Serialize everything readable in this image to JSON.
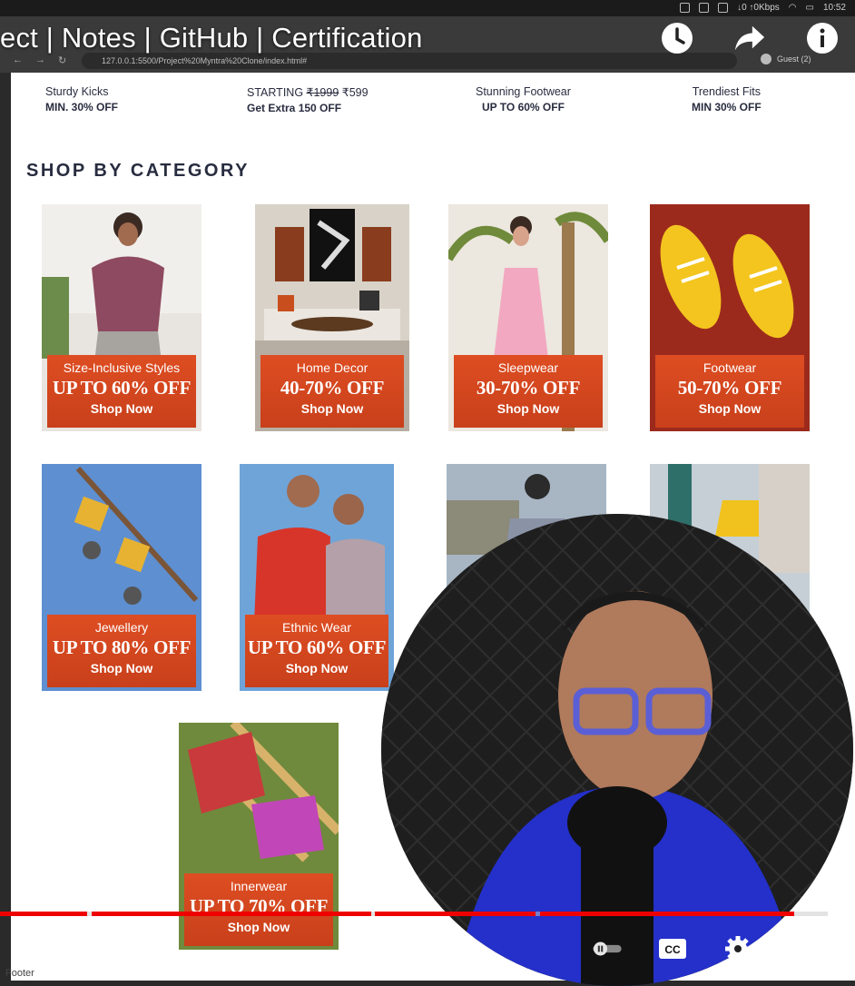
{
  "video": {
    "title": "ect | Notes | GitHub | Certification",
    "icons": [
      "clock-icon",
      "share-icon",
      "info-icon"
    ],
    "progress_fraction": 0.93,
    "cc_label": "CC"
  },
  "system_bar": {
    "time": "10:52",
    "network": "↓0 ↑0Kbps"
  },
  "browser": {
    "url": "127.0.0.1:5500/Project%20Myntra%20Clone/index.html#",
    "profile": "Guest (2)"
  },
  "promos": [
    {
      "title": "Sturdy Kicks",
      "sub": "MIN. 30% OFF"
    },
    {
      "title_prefix": "STARTING ",
      "old_price": "₹1999",
      "new_price": " ₹599",
      "sub": "Get Extra 150 OFF"
    },
    {
      "title": "Stunning Footwear",
      "sub": "UP TO 60% OFF"
    },
    {
      "title": "Trendiest Fits",
      "sub": "MIN 30% OFF"
    }
  ],
  "section_title": "SHOP BY CATEGORY",
  "categories": [
    {
      "name": "Size-Inclusive Styles",
      "offer": "UP TO 60% OFF",
      "cta": "Shop Now"
    },
    {
      "name": "Home Decor",
      "offer": "40-70% OFF",
      "cta": "Shop Now"
    },
    {
      "name": "Sleepwear",
      "offer": "30-70% OFF",
      "cta": "Shop Now"
    },
    {
      "name": "Footwear",
      "offer": "50-70% OFF",
      "cta": "Shop Now"
    },
    {
      "name": "Jewellery",
      "offer": "UP TO 80% OFF",
      "cta": "Shop Now"
    },
    {
      "name": "Ethnic Wear",
      "offer": "UP TO 60% OFF",
      "cta": "Shop Now"
    },
    {
      "name": "Innerwear",
      "offer": "UP TO 70% OFF",
      "cta": "Shop Now"
    }
  ],
  "footer_label": "Footer",
  "colors": {
    "badge": "#d9481f",
    "progress": "#ee0000"
  }
}
